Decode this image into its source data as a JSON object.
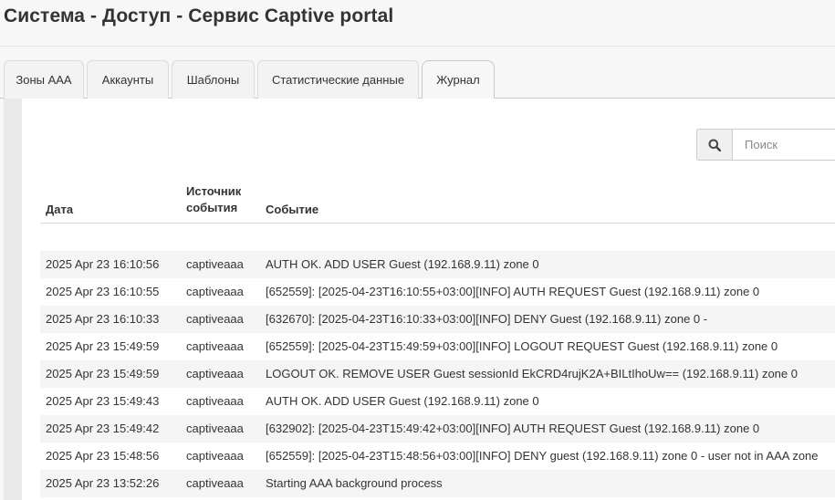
{
  "page": {
    "title": "Система - Доступ - Сервис Captive portal"
  },
  "tabs": [
    {
      "label": "Зоны AAA"
    },
    {
      "label": "Аккаунты"
    },
    {
      "label": "Шаблоны"
    },
    {
      "label": "Статистические данные"
    },
    {
      "label": "Журнал",
      "active": true
    }
  ],
  "search": {
    "icon": "search-icon",
    "placeholder": "Поиск",
    "value": ""
  },
  "table": {
    "columns": {
      "date": "Дата",
      "source": "Источник события",
      "event": "Событие"
    },
    "rows": [
      {
        "date": "2025 Apr 23 16:10:56",
        "source": "captiveaaa",
        "event": "AUTH OK. ADD USER Guest (192.168.9.11) zone 0"
      },
      {
        "date": "2025 Apr 23 16:10:55",
        "source": "captiveaaa",
        "event": "[652559]: [2025-04-23T16:10:55+03:00][INFO] AUTH REQUEST Guest (192.168.9.11) zone 0"
      },
      {
        "date": "2025 Apr 23 16:10:33",
        "source": "captiveaaa",
        "event": "[632670]: [2025-04-23T16:10:33+03:00][INFO] DENY Guest (192.168.9.11) zone 0 -"
      },
      {
        "date": "2025 Apr 23 15:49:59",
        "source": "captiveaaa",
        "event": "[652559]: [2025-04-23T15:49:59+03:00][INFO] LOGOUT REQUEST Guest (192.168.9.11) zone 0"
      },
      {
        "date": "2025 Apr 23 15:49:59",
        "source": "captiveaaa",
        "event": "LOGOUT OK. REMOVE USER Guest sessionId EkCRD4rujK2A+BILtIhoUw== (192.168.9.11) zone 0"
      },
      {
        "date": "2025 Apr 23 15:49:43",
        "source": "captiveaaa",
        "event": "AUTH OK. ADD USER Guest (192.168.9.11) zone 0"
      },
      {
        "date": "2025 Apr 23 15:49:42",
        "source": "captiveaaa",
        "event": "[632902]: [2025-04-23T15:49:42+03:00][INFO] AUTH REQUEST Guest (192.168.9.11) zone 0"
      },
      {
        "date": "2025 Apr 23 15:48:56",
        "source": "captiveaaa",
        "event": "[652559]: [2025-04-23T15:48:56+03:00][INFO] DENY guest (192.168.9.11) zone 0 - user not in AAA zone"
      },
      {
        "date": "2025 Apr 23 13:52:26",
        "source": "captiveaaa",
        "event": "Starting AAA background process"
      }
    ]
  },
  "colors": {
    "background": "#f7f7f7",
    "panel": "#ffffff",
    "stripe": "#f5f5f5",
    "text": "#333333"
  }
}
